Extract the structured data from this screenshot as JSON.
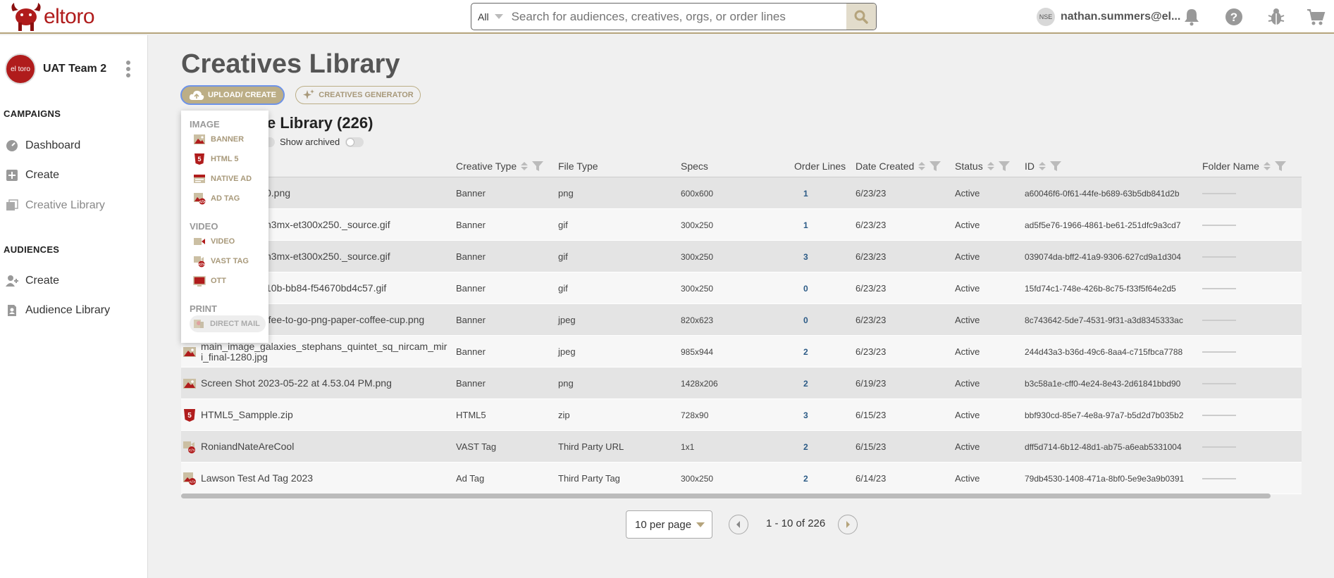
{
  "app": {
    "brand": "eltoro",
    "search": {
      "scope": "All",
      "placeholder": "Search for audiences, creatives, orgs, or order lines"
    },
    "user": {
      "initials": "NSE",
      "name": "nathan.summers@el..."
    }
  },
  "sidebar": {
    "team_name": "UAT Team 2",
    "team_avatar_text": "el toro",
    "sections": [
      {
        "heading": "CAMPAIGNS",
        "items": [
          {
            "label": "Dashboard",
            "icon": "dashboard-icon"
          },
          {
            "label": "Create",
            "icon": "plus-square-icon"
          },
          {
            "label": "Creative Library",
            "icon": "images-icon",
            "active": true
          }
        ]
      },
      {
        "heading": "AUDIENCES",
        "items": [
          {
            "label": "Create",
            "icon": "add-user-icon"
          },
          {
            "label": "Audience Library",
            "icon": "document-user-icon"
          }
        ]
      }
    ]
  },
  "main": {
    "title": "Creatives Library",
    "upload_label": "UPLOAD/ CREATE",
    "generator_label": "CREATIVES GENERATOR",
    "library_count_label": "e Library (226)",
    "show_archived_label": "Show archived"
  },
  "dropdown": {
    "groups": [
      {
        "label": "IMAGE",
        "items": [
          "BANNER",
          "HTML 5",
          "NATIVE AD",
          "AD TAG"
        ]
      },
      {
        "label": "VIDEO",
        "items": [
          "VIDEO",
          "VAST TAG",
          "OTT"
        ]
      },
      {
        "label": "PRINT",
        "items": [
          "DIRECT MAIL"
        ]
      }
    ]
  },
  "table": {
    "headers": {
      "creative_type": "Creative Type",
      "file_type": "File Type",
      "specs": "Specs",
      "order_lines": "Order Lines",
      "date_created": "Date Created",
      "status": "Status",
      "id": "ID",
      "folder_name": "Folder Name"
    },
    "rows": [
      {
        "name": "0.png",
        "type": "Banner",
        "file": "png",
        "specs": "600x600",
        "ol": "1",
        "date": "6/23/23",
        "status": "Active",
        "id": "a60046f6-0f61-44fe-b689-63b5db841d2b"
      },
      {
        "name": "h3mx-et300x250._source.gif",
        "type": "Banner",
        "file": "gif",
        "specs": "300x250",
        "ol": "1",
        "date": "6/23/23",
        "status": "Active",
        "id": "ad5f5e76-1966-4861-be61-251dfc9a3cd7"
      },
      {
        "name": "h3mx-et300x250._source.gif",
        "type": "Banner",
        "file": "gif",
        "specs": "300x250",
        "ol": "3",
        "date": "6/23/23",
        "status": "Active",
        "id": "039074da-bff2-41a9-9306-627cd9a1d304"
      },
      {
        "name": "10b-bb84-f54670bd4c57.gif",
        "type": "Banner",
        "file": "gif",
        "specs": "300x250",
        "ol": "0",
        "date": "6/23/23",
        "status": "Active",
        "id": "15fd74c1-748e-426b-8c75-f33f5f64e2d5"
      },
      {
        "name": "ffee-to-go-png-paper-coffee-cup.png",
        "type": "Banner",
        "file": "jpeg",
        "specs": "820x623",
        "ol": "0",
        "date": "6/23/23",
        "status": "Active",
        "id": "8c743642-5de7-4531-9f31-a3d8345333ac"
      },
      {
        "name": "main_image_galaxies_stephans_quintet_sq_nircam_mir",
        "name2": "i_final-1280.jpg",
        "type": "Banner",
        "file": "jpeg",
        "specs": "985x944",
        "ol": "2",
        "date": "6/23/23",
        "status": "Active",
        "id": "244d43a3-b36d-49c6-8aa4-c715fbca7788"
      },
      {
        "name": "Screen Shot 2023-05-22 at 4.53.04 PM.png",
        "type": "Banner",
        "file": "png",
        "specs": "1428x206",
        "ol": "2",
        "date": "6/19/23",
        "status": "Active",
        "id": "b3c58a1e-cff0-4e24-8e43-2d61841bbd90"
      },
      {
        "name": "HTML5_Sampple.zip",
        "type": "HTML5",
        "file": "zip",
        "specs": "728x90",
        "ol": "3",
        "date": "6/15/23",
        "status": "Active",
        "id": "bbf930cd-85e7-4e8a-97a7-b5d2d7b035b2"
      },
      {
        "name": "RoniandNateAreCool",
        "type": "VAST Tag",
        "file": "Third Party URL",
        "specs": "1x1",
        "ol": "2",
        "date": "6/15/23",
        "status": "Active",
        "id": "dff5d714-6b12-48d1-ab75-a6eab5331004"
      },
      {
        "name": "Lawson Test Ad Tag 2023",
        "type": "Ad Tag",
        "file": "Third Party Tag",
        "specs": "300x250",
        "ol": "2",
        "date": "6/14/23",
        "status": "Active",
        "id": "79db4530-1408-471a-8bf0-5e9e3a9b0391"
      }
    ]
  },
  "pagination": {
    "per_page": "10 per page",
    "range": "1 - 10 of 226"
  },
  "colors": {
    "accent": "#b5a47c",
    "brand_red": "#b01c1c",
    "link": "#2c5b86",
    "focus": "#6e93e8"
  }
}
